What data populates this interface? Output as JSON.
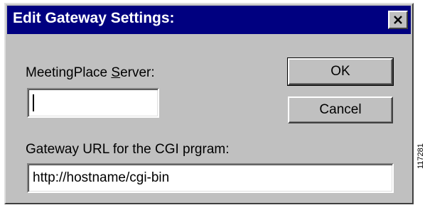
{
  "dialog": {
    "title": "Edit Gateway Settings:",
    "close_icon": "close-icon"
  },
  "server": {
    "label_before": "MeetingPlace ",
    "label_accel": "S",
    "label_after": "erver:",
    "value": ""
  },
  "gateway": {
    "label": "Gateway URL for the CGI prgram:",
    "value": "http://hostname/cgi-bin"
  },
  "buttons": {
    "ok_label": "OK",
    "cancel_label": "Cancel"
  },
  "figure_id": "117281",
  "colors": {
    "titlebar": "#000080",
    "dialog_face": "#c0c0c0"
  }
}
